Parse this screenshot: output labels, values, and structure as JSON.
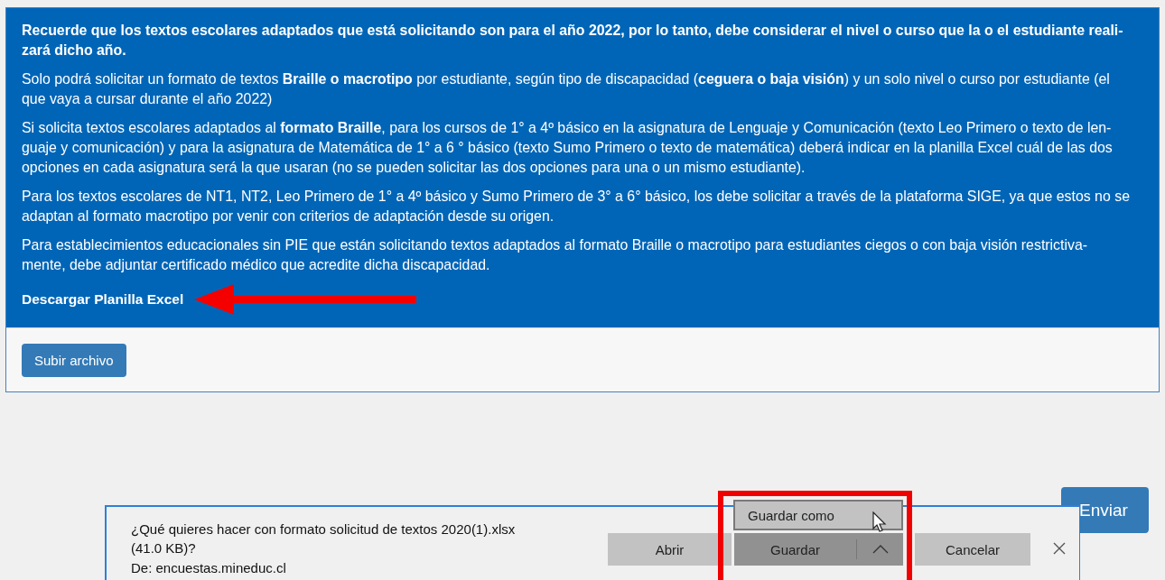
{
  "notice": {
    "paragraphs": [
      {
        "bold": true,
        "lines": [
          "Recuerde que los textos escolares adaptados que está solicitando son para el año 2022, por lo tanto, debe considerar el nivel o curso que la o el estudiante reali-",
          "zará dicho año."
        ]
      },
      {
        "bold": false,
        "lines": [
          "Solo podrá solicitar un formato de textos **Braille o macrotipo** por estudiante, según tipo de discapacidad (**ceguera o baja visión**) y un solo nivel o curso por estudiante (el",
          "que vaya a cursar durante el año 2022)"
        ]
      },
      {
        "bold": false,
        "lines": [
          "Si solicita textos escolares adaptados al **formato Braille**, para los cursos de 1° a 4º básico en la asignatura de Lenguaje y Comunicación (texto Leo Primero o texto de len-",
          "guaje y comunicación) y para la asignatura de Matemática de 1° a 6 ° básico (texto Sumo Primero o texto de matemática) deberá indicar en la planilla Excel cuál de las dos",
          "opciones en cada asignatura será la que usaran (no se pueden solicitar las dos opciones para una o un mismo estudiante)."
        ]
      },
      {
        "bold": false,
        "lines": [
          "Para los textos escolares de NT1, NT2, Leo Primero de 1° a 4º básico y Sumo Primero de 3° a 6° básico, los debe solicitar a través de la plataforma SIGE, ya que estos no se",
          "adaptan al formato macrotipo por venir con criterios de adaptación desde su origen."
        ]
      },
      {
        "bold": false,
        "lines": [
          "Para establecimientos educacionales sin PIE que están solicitando textos adaptados al formato Braille o macrotipo para estudiantes ciegos o con baja visión restrictiva-",
          "mente, debe adjuntar certificado médico que acredite dicha discapacidad."
        ]
      }
    ],
    "link": "Descargar Planilla Excel"
  },
  "upload_button": "Subir archivo",
  "submit_button": "Enviar",
  "download_bar": {
    "message_lines": [
      "¿Qué quieres hacer con formato solicitud de textos 2020(1).xlsx",
      "(41.0 KB)?"
    ],
    "source": "De: encuestas.mineduc.cl",
    "buttons": [
      {
        "label": "Abrir",
        "kind": "plain"
      },
      {
        "label": "Guardar",
        "kind": "split"
      },
      {
        "label": "Cancelar",
        "kind": "plain"
      }
    ],
    "menu": [
      "Guardar como"
    ]
  }
}
